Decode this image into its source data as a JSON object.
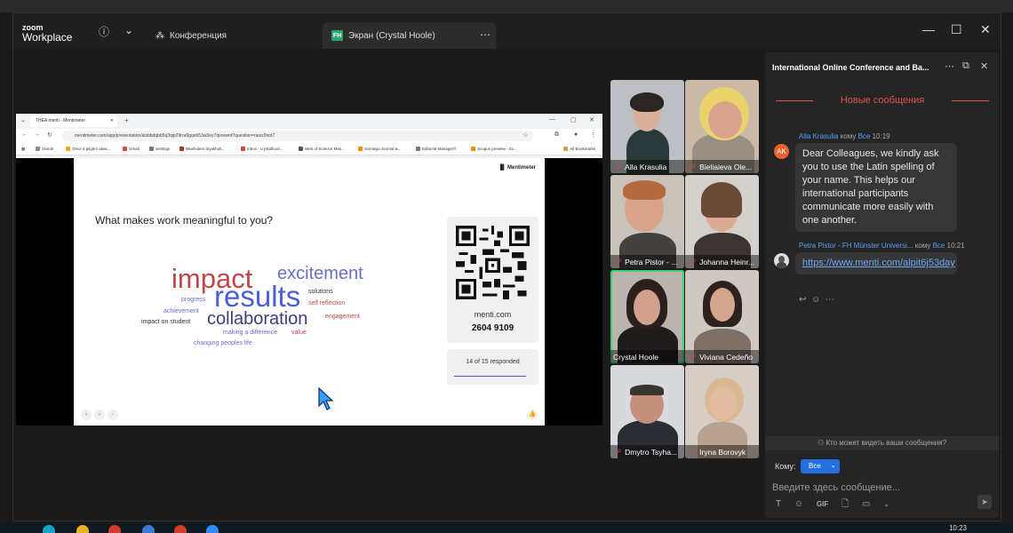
{
  "window": {
    "logo_line1": "zoom",
    "logo_line2": "Workplace",
    "tab_conference": "Конференция",
    "tab_screen_badge": "FH",
    "tab_screen": "Экран (Crystal Hoole)"
  },
  "browser": {
    "tab_title": "THEA menti - Mentimeter",
    "url": "mentimeter.com/app/presentation/alsbbdqbb5q3qip29rra9gqeb53w3ey7/present?question=raoiz9not7",
    "bookmarks": [
      "Oracle",
      "Once a pilgrim alwa...",
      "Gmail",
      "Settings",
      "Błuehuleni Siyakhok...",
      "Inbox - crystalhool...",
      "Web of Science Mas...",
      "Scimago Journal &...",
      "Editorial Manager®",
      "Scopus preview - Sc..."
    ],
    "all_bookmarks": "All Bookmarks"
  },
  "slide": {
    "brand": "Mentimeter",
    "question": "What makes work meaningful to you?",
    "words": [
      {
        "text": "impact",
        "color": "#c0464a"
      },
      {
        "text": "excitement",
        "color": "#6a6ec8"
      },
      {
        "text": "results",
        "color": "#4a5ed8"
      },
      {
        "text": "collaboration",
        "color": "#3b3e7a"
      },
      {
        "text": "solutions",
        "color": "#333333"
      },
      {
        "text": "self reflection",
        "color": "#c0464a"
      },
      {
        "text": "progress",
        "color": "#6a6ec8"
      },
      {
        "text": "achievement",
        "color": "#6a6ec8"
      },
      {
        "text": "engagement",
        "color": "#c0464a"
      },
      {
        "text": "impact on student",
        "color": "#333333"
      },
      {
        "text": "making a difference",
        "color": "#6a6ec8"
      },
      {
        "text": "value",
        "color": "#c0464a"
      },
      {
        "text": "changing peoples life",
        "color": "#6a6ec8"
      }
    ],
    "join_site": "menti.com",
    "join_code": "2604 9109",
    "responded_text": "14 of 15 responded"
  },
  "participants": [
    {
      "name": "Alla Krasulia",
      "muted": true
    },
    {
      "name": "Bieliaieva Ole...",
      "muted": true
    },
    {
      "name": "Petra Pistor - ...",
      "muted": true
    },
    {
      "name": "Johanna Heinr...",
      "muted": true
    },
    {
      "name": "Crystal Hoole",
      "muted": true,
      "speaking": true
    },
    {
      "name": "Viviana Cedeño",
      "muted": true
    },
    {
      "name": "Dmytro Tsyha...",
      "muted": true
    },
    {
      "name": "Iryna Borovyk",
      "muted": true
    }
  ],
  "chat": {
    "title": "International Online Conference and Ba...",
    "new_messages": "Новые сообщения",
    "messages": [
      {
        "initials": "AK",
        "sender": "Alla Krasulia",
        "to_word": "кому",
        "to": "Все",
        "time": "10:19",
        "text": "Dear Colleagues, we kindly ask you to use the Latin spelling of your name. This helps our international participants communicate more easily with one another."
      },
      {
        "sender": "Petra Pistor - FH Münster Universi...",
        "to_word": "кому",
        "to": "Все",
        "time": "10:21",
        "link": "https://www.menti.com/alpit6j53day"
      }
    ],
    "who_can_see": "Кто может видеть ваши сообщения?",
    "to_label": "Кому:",
    "to_value": "Все",
    "input_placeholder": "Введите здесь сообщение...",
    "toolbar_gif": "GIF"
  },
  "taskbar": {
    "time": "10:23"
  }
}
